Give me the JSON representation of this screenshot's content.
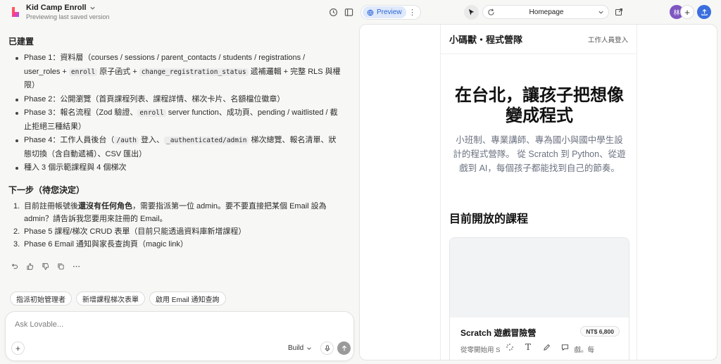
{
  "header": {
    "project_title": "Kid Camp Enroll",
    "project_subtitle": "Previewing last saved version",
    "preview_label": "Preview",
    "route": "Homepage",
    "avatar_initial": "林"
  },
  "chat": {
    "built_heading": "已建置",
    "phase1_a": "Phase 1：資料層（courses / sessions / parent_contacts / students / registrations /",
    "phase1_b": "user_roles + ",
    "phase1_code1": "enroll",
    "phase1_c": " 原子函式 + ",
    "phase1_code2": "change_registration_status",
    "phase1_d": " 遞補邏輯 + 完整 RLS 與權",
    "phase1_e": "限）",
    "phase2": "Phase 2：公開瀏覽（首頁課程列表、課程詳情、梯次卡片、名額檔位徽章）",
    "phase3_a": "Phase 3：報名流程（Zod 驗證、",
    "phase3_code": "enroll",
    "phase3_b": " server function、成功頁、pending / waitlisted / 截",
    "phase3_c": "止拒絕三種結果）",
    "phase4_a": "Phase 4：工作人員後台（",
    "phase4_code1": "/auth",
    "phase4_b": " 登入、",
    "phase4_code2": "_authenticated/admin",
    "phase4_c": " 梯次總覽、報名清單、狀",
    "phase4_d": "態切換（含自動遞補）、CSV 匯出）",
    "seed": "種入 3 個示範課程與 4 個梯次",
    "next_heading": "下一步（待您決定）",
    "next1_a": "目前註冊帳號後",
    "next1_bold": "還沒有任何角色",
    "next1_b": "，需要指派第一位 admin。要不要直接把某個 Email 設為",
    "next1_c": "admin？請告訴我您要用來註冊的 Email。",
    "next2": "Phase 5 課程/梯次 CRUD 表單（目前只能透過資料庫新增課程）",
    "next3": "Phase 6 Email 通知與家長查詢頁（magic link）",
    "chips": [
      "指派初始管理者",
      "新增課程梯次表單",
      "啟用 Email 通知查詢"
    ],
    "input_placeholder": "Ask Lovable...",
    "mode_label": "Build"
  },
  "site": {
    "brand": "小碼獸・程式營隊",
    "staff_login": "工作人員登入",
    "hero_line1": "在台北，讓孩子把想像",
    "hero_line2": "變成程式",
    "hero_sub1": "小班制、專業講師、專為國小與國中學生設",
    "hero_sub2": "計的程式營隊。 從 Scratch 到 Python、從遊",
    "hero_sub3": "戲到 AI，每個孩子都能找到自己的節奏。",
    "section_title": "目前開放的課程",
    "course_name": "Scratch 遊戲冒險營",
    "course_price": "NT$ 6,800",
    "course_desc1": "從零開始用 S",
    "course_desc2": "小遊戲。每"
  },
  "colors": {
    "accent": "#3b6fe0",
    "preview_tab": "#dfe9fb"
  }
}
